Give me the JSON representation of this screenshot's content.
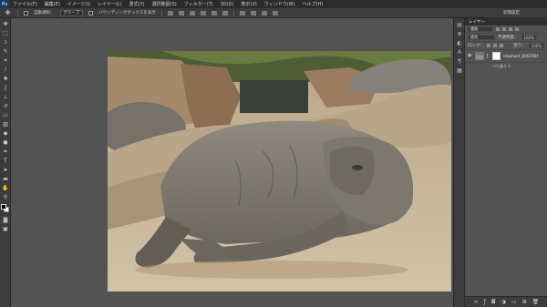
{
  "app": {
    "logo": "Ps"
  },
  "menu": [
    "ファイル(F)",
    "編集(E)",
    "イメージ(I)",
    "レイヤー(L)",
    "書式(Y)",
    "選択範囲(S)",
    "フィルター(T)",
    "3D(D)",
    "表示(V)",
    "ウィンドウ(W)",
    "ヘルプ(H)"
  ],
  "options": {
    "auto_select": "自動選択：",
    "auto_select_target": "グループ",
    "transform_controls": "バウンディングボックスを表示"
  },
  "workspace": {
    "label": "初期設定"
  },
  "tools": [
    "move-tool-icon",
    "marquee-tool-icon",
    "lasso-tool-icon",
    "quick-select-tool-icon",
    "crop-tool-icon",
    "eyedropper-tool-icon",
    "healing-tool-icon",
    "brush-tool-icon",
    "clone-stamp-tool-icon",
    "history-brush-tool-icon",
    "eraser-tool-icon",
    "gradient-tool-icon",
    "blur-tool-icon",
    "dodge-tool-icon",
    "pen-tool-icon",
    "type-tool-icon",
    "path-select-tool-icon",
    "shape-tool-icon",
    "hand-tool-icon",
    "zoom-tool-icon"
  ],
  "colors": {
    "foreground": "#000000",
    "background": "#ffffff"
  },
  "layers_panel": {
    "title": "レイヤー",
    "kind_label": "種類",
    "blend_mode": "通常",
    "opacity_label": "不透明度：",
    "opacity_value": "100%",
    "lock_label": "ロック：",
    "fill_label": "塗り：",
    "fill_value": "100%",
    "layers": [
      {
        "name": "elephant_00025664.jpg",
        "effect": "べた塗り 1"
      }
    ]
  }
}
